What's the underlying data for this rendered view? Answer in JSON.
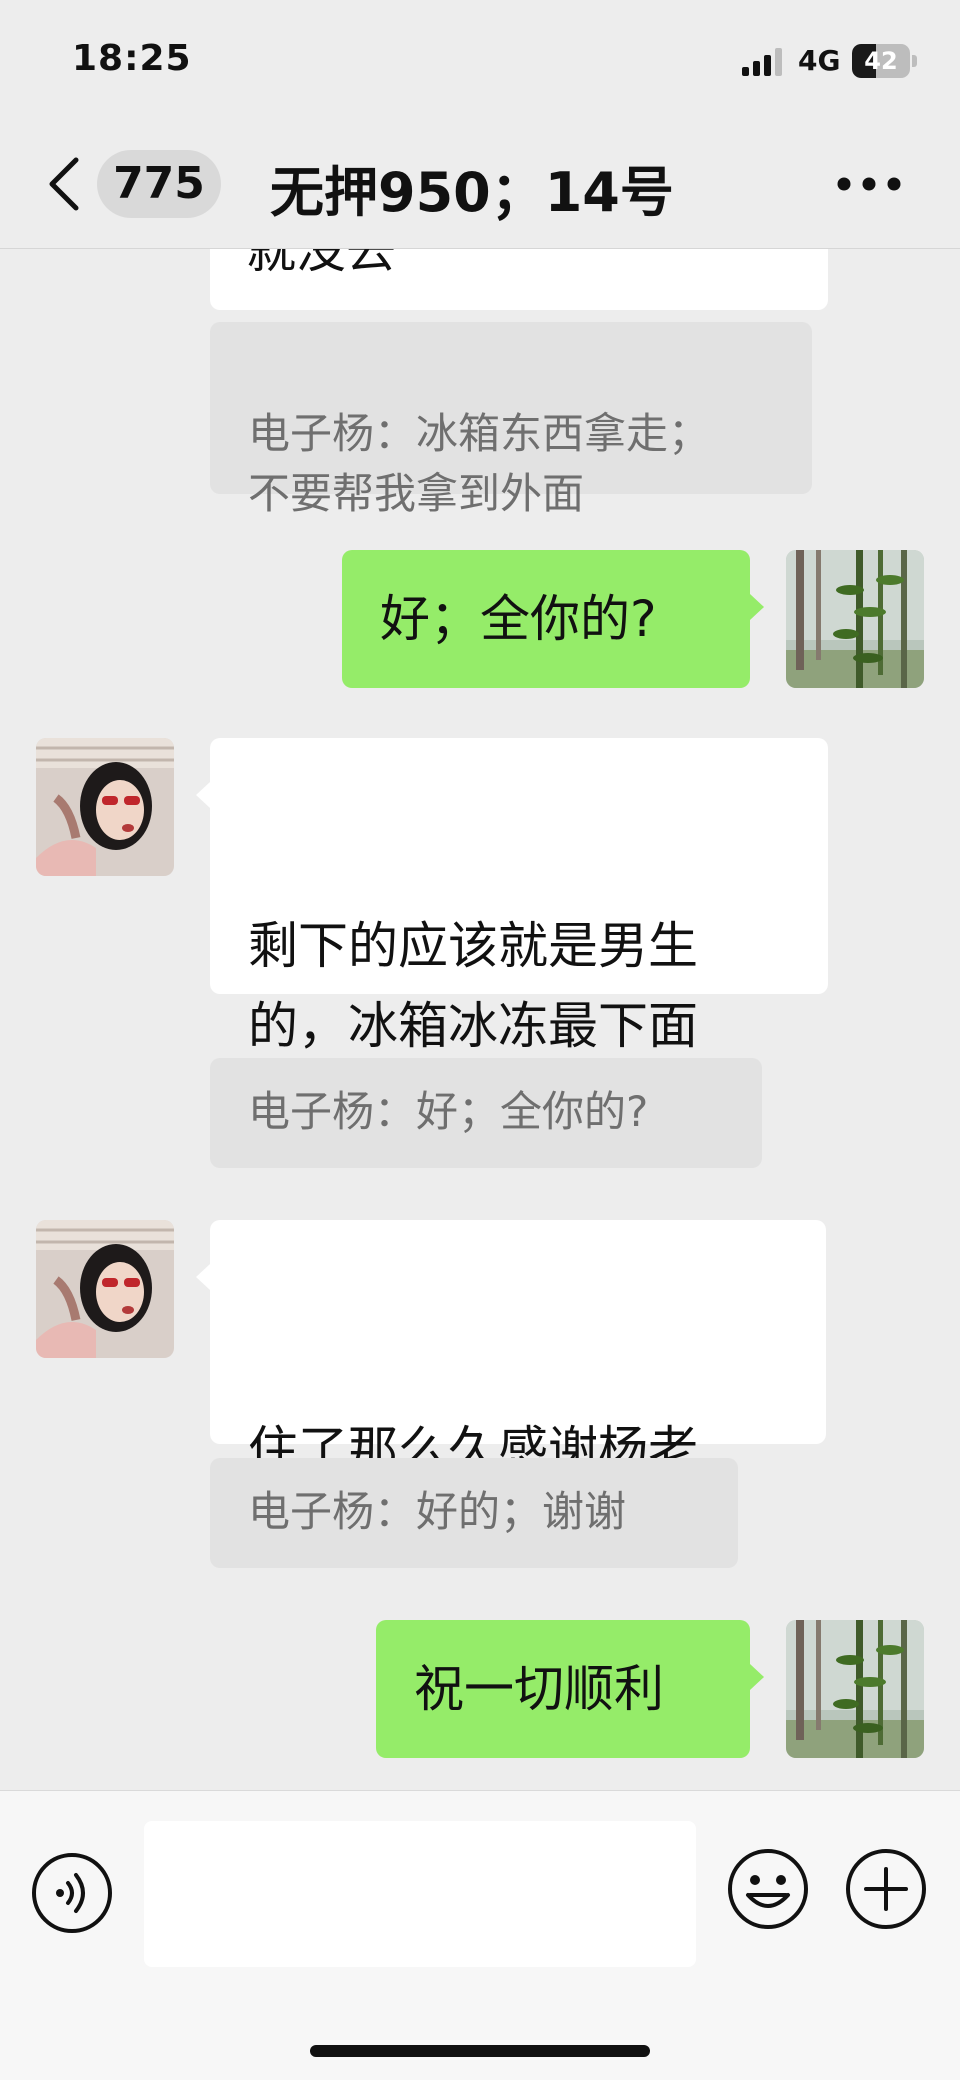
{
  "status_bar": {
    "time": "18:25",
    "network": "4G",
    "battery_level": "42",
    "battery_fraction": 0.42,
    "signal_bars_active": 3,
    "signal_bars_total": 4
  },
  "header": {
    "unread_count": "775",
    "title": "无押950；14号",
    "back_icon": "chevron-left-icon",
    "more_icon": "ellipsis-icon"
  },
  "messages": [
    {
      "id": "m1",
      "side": "in",
      "text": "就没去",
      "partial": true
    },
    {
      "id": "q1",
      "type": "quote",
      "text": "电子杨：冰箱东西拿走；\n不要帮我拿到外面"
    },
    {
      "id": "m2",
      "side": "out",
      "text": "好；全你的?"
    },
    {
      "id": "m3",
      "side": "in",
      "text": "剩下的应该就是男生\n的，冰箱冰冻最下面\n那个盒子是"
    },
    {
      "id": "q2",
      "type": "quote",
      "text": "电子杨：好；全你的?"
    },
    {
      "id": "m4",
      "side": "in",
      "text": "住了那么久感谢杨老\n师的照顾",
      "emoji": "handshake-emoji"
    },
    {
      "id": "q3",
      "type": "quote",
      "text": "电子杨：好的；谢谢"
    },
    {
      "id": "m5",
      "side": "out",
      "text": "祝一切顺利"
    }
  ],
  "input_bar": {
    "voice_icon": "voice-icon",
    "emoji_icon": "smiley-icon",
    "plus_icon": "plus-circle-icon",
    "input_value": ""
  },
  "colors": {
    "background": "#ededed",
    "outgoing_bubble": "#95ec69",
    "incoming_bubble": "#ffffff",
    "quote_background": "#e2e2e2",
    "quote_text": "#6f6f6f"
  }
}
